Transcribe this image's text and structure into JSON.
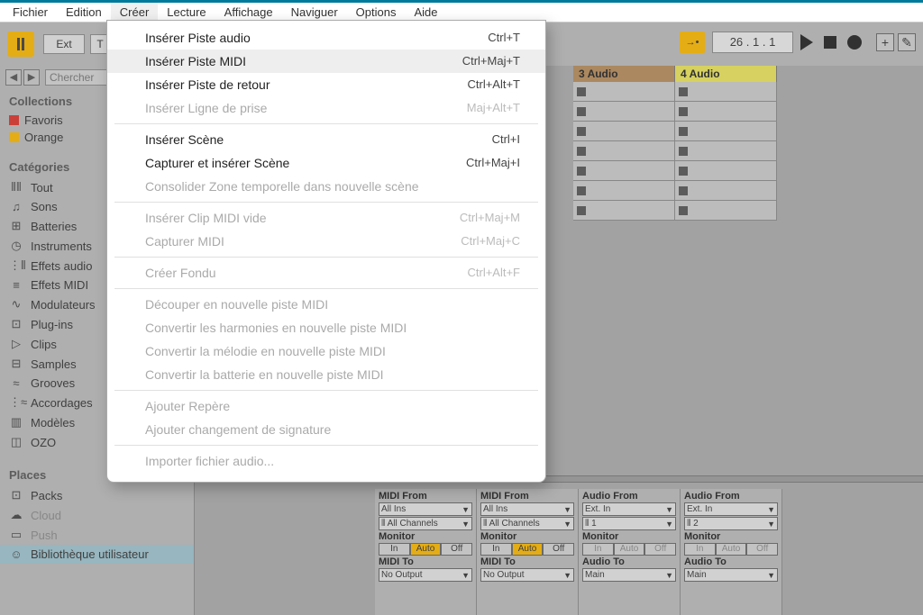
{
  "menubar": [
    "Fichier",
    "Edition",
    "Créer",
    "Lecture",
    "Affichage",
    "Naviguer",
    "Options",
    "Aide"
  ],
  "menubar_open_index": 2,
  "toolbar": {
    "ext_label": "Ext",
    "t_label": "T",
    "position": "26 .   1 .   1",
    "key_arrow": "→•"
  },
  "dropdown": {
    "groups": [
      [
        {
          "label": "Insérer Piste audio",
          "shortcut": "Ctrl+T",
          "disabled": false
        },
        {
          "label": "Insérer Piste MIDI",
          "shortcut": "Ctrl+Maj+T",
          "disabled": false,
          "hover": true
        },
        {
          "label": "Insérer Piste de retour",
          "shortcut": "Ctrl+Alt+T",
          "disabled": false
        },
        {
          "label": "Insérer Ligne de prise",
          "shortcut": "Maj+Alt+T",
          "disabled": true
        }
      ],
      [
        {
          "label": "Insérer Scène",
          "shortcut": "Ctrl+I",
          "disabled": false
        },
        {
          "label": "Capturer et insérer Scène",
          "shortcut": "Ctrl+Maj+I",
          "disabled": false
        },
        {
          "label": "Consolider Zone temporelle dans nouvelle scène",
          "shortcut": "",
          "disabled": true
        }
      ],
      [
        {
          "label": "Insérer Clip MIDI vide",
          "shortcut": "Ctrl+Maj+M",
          "disabled": true
        },
        {
          "label": "Capturer MIDI",
          "shortcut": "Ctrl+Maj+C",
          "disabled": true
        }
      ],
      [
        {
          "label": "Créer Fondu",
          "shortcut": "Ctrl+Alt+F",
          "disabled": true
        }
      ],
      [
        {
          "label": "Découper en nouvelle piste MIDI",
          "shortcut": "",
          "disabled": true
        },
        {
          "label": "Convertir les harmonies en nouvelle piste MIDI",
          "shortcut": "",
          "disabled": true
        },
        {
          "label": "Convertir la mélodie en nouvelle piste MIDI",
          "shortcut": "",
          "disabled": true
        },
        {
          "label": "Convertir la batterie en nouvelle piste MIDI",
          "shortcut": "",
          "disabled": true
        }
      ],
      [
        {
          "label": "Ajouter Repère",
          "shortcut": "",
          "disabled": true
        },
        {
          "label": "Ajouter changement de signature",
          "shortcut": "",
          "disabled": true
        }
      ],
      [
        {
          "label": "Importer fichier audio...",
          "shortcut": "",
          "disabled": true
        }
      ]
    ]
  },
  "browser": {
    "search_placeholder": "Chercher",
    "collections_hdr": "Collections",
    "tags": [
      {
        "color": "#d9332b",
        "label": "Favoris"
      },
      {
        "color": "#f7b500",
        "label": "Orange"
      }
    ],
    "categories_hdr": "Catégories",
    "categories": [
      {
        "icon": "⦀⦀",
        "label": "Tout"
      },
      {
        "icon": "♫",
        "label": "Sons"
      },
      {
        "icon": "⊞",
        "label": "Batteries"
      },
      {
        "icon": "◷",
        "label": "Instruments"
      },
      {
        "icon": "⋮⦀",
        "label": "Effets audio"
      },
      {
        "icon": "≡",
        "label": "Effets MIDI"
      },
      {
        "icon": "∿",
        "label": "Modulateurs"
      },
      {
        "icon": "⊡",
        "label": "Plug-ins"
      },
      {
        "icon": "▷",
        "label": "Clips"
      },
      {
        "icon": "⊟",
        "label": "Samples"
      },
      {
        "icon": "≈",
        "label": "Grooves"
      },
      {
        "icon": "⋮≈",
        "label": "Accordages"
      },
      {
        "icon": "▥",
        "label": "Modèles"
      },
      {
        "icon": "◫",
        "label": "OZO"
      }
    ],
    "places_hdr": "Places",
    "places": [
      {
        "icon": "⊡",
        "label": "Packs"
      },
      {
        "icon": "☁",
        "label": "Cloud",
        "dim": true
      },
      {
        "icon": "▭",
        "label": "Push",
        "dim": true
      },
      {
        "icon": "☺",
        "label": "Bibliothèque utilisateur",
        "selected": true
      }
    ]
  },
  "tracks": {
    "headers": [
      {
        "label": "3 Audio",
        "cls": "t3"
      },
      {
        "label": "4 Audio",
        "cls": "t4"
      }
    ],
    "clip_rows": 7
  },
  "mixer": {
    "midi_from": "MIDI From",
    "audio_from": "Audio From",
    "all_ins": "All Ins",
    "ext_in": "Ext. In",
    "i_all_channels": "⦀ All Channels",
    "i_1": "⦀ 1",
    "i_2": "⦀ 2",
    "monitor": "Monitor",
    "in": "In",
    "auto": "Auto",
    "off": "Off",
    "midi_to": "MIDI To",
    "audio_to": "Audio To",
    "no_output": "No Output",
    "main": "Main"
  }
}
